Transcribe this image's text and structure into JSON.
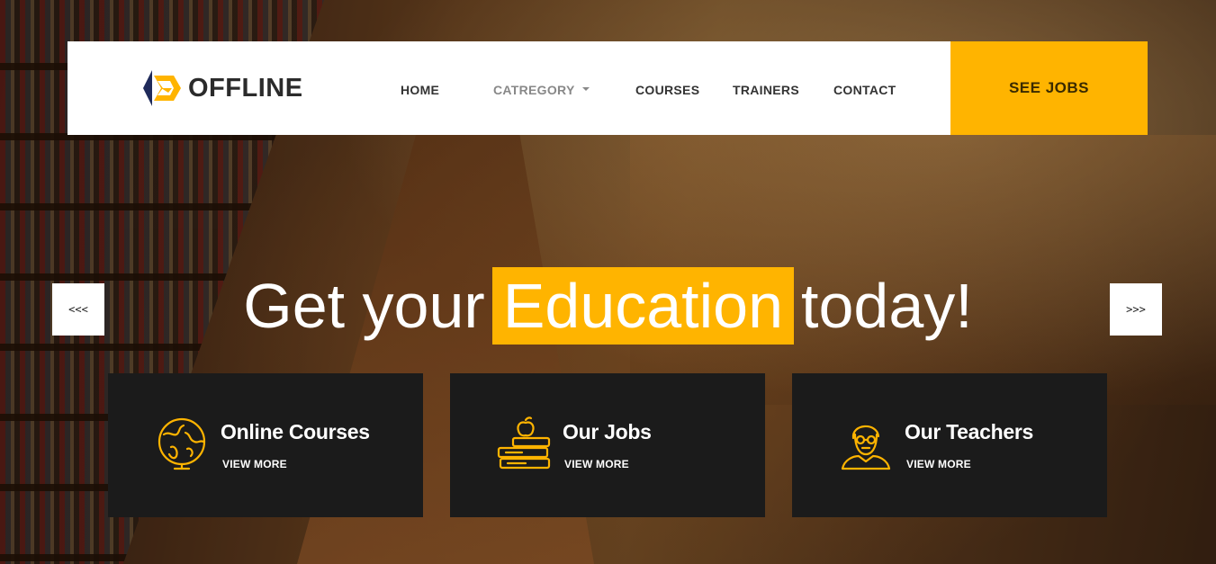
{
  "brand": {
    "name": "OFFLINE"
  },
  "nav": {
    "items": [
      {
        "label": "HOME"
      },
      {
        "label": "CATREGORY"
      },
      {
        "label": "COURSES"
      },
      {
        "label": "TRAINERS"
      },
      {
        "label": "CONTACT"
      }
    ],
    "cta": "SEE JOBS"
  },
  "hero": {
    "headline_before": "Get your",
    "headline_highlight": "Education",
    "headline_after": "today!",
    "prev_arrow": "<<<",
    "next_arrow": ">>>"
  },
  "cards": [
    {
      "title": "Online Courses",
      "link": "VIEW MORE",
      "icon": "globe-icon"
    },
    {
      "title": "Our Jobs",
      "link": "VIEW MORE",
      "icon": "apple-books-icon"
    },
    {
      "title": "Our Teachers",
      "link": "VIEW MORE",
      "icon": "teacher-icon"
    }
  ],
  "colors": {
    "accent": "#ffb400",
    "card_bg": "#1b1b1b",
    "logo_navy": "#1f2a5a"
  }
}
